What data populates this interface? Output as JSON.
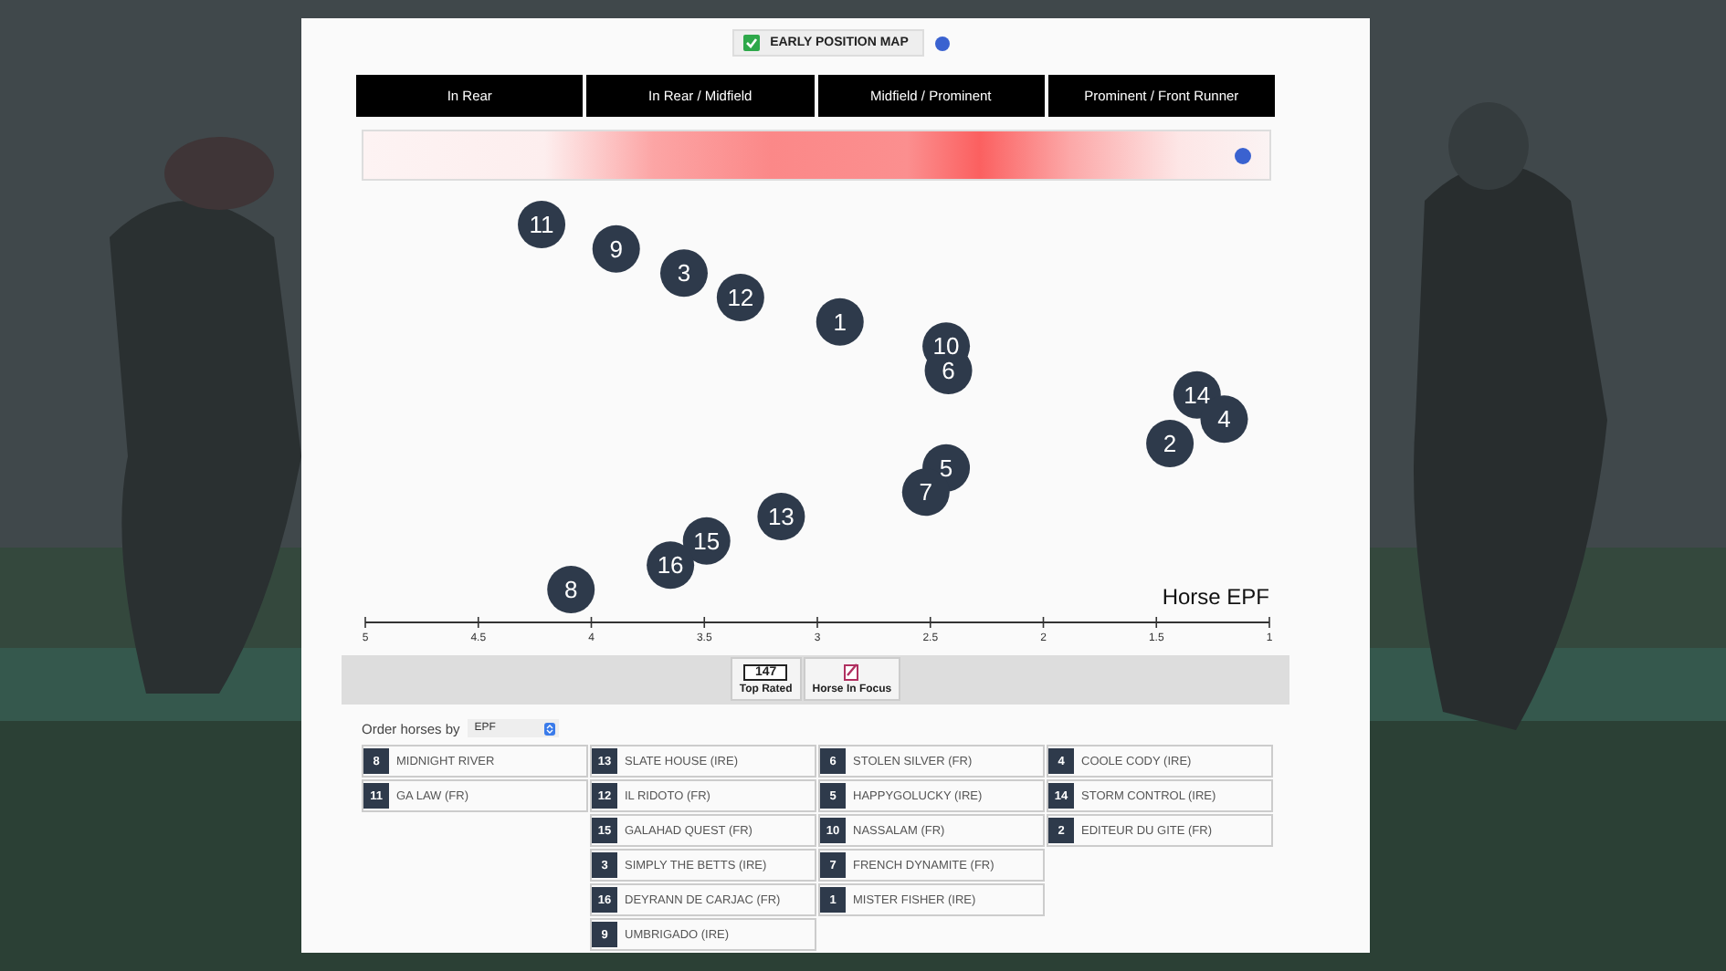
{
  "toggle": {
    "label": "EARLY POSITION MAP",
    "checked": true
  },
  "bands": [
    "In Rear",
    "In Rear / Midfield",
    "Midfield / Prominent",
    "Prominent / Front Runner"
  ],
  "plot": {
    "chart_data": {
      "type": "scatter",
      "xlabel": "Horse EPF",
      "xlim": [
        5,
        1
      ],
      "orientation": "horizontal",
      "xticks": [
        5,
        4.5,
        4,
        3.5,
        3,
        2.5,
        2,
        1.5,
        1
      ],
      "categories": [
        "11",
        "9",
        "3",
        "12",
        "1",
        "10",
        "6",
        "14",
        "4",
        "2",
        "5",
        "7",
        "13",
        "15",
        "16",
        "8"
      ],
      "series": [
        {
          "color": "#2e3a4b",
          "values": [
            4.22,
            3.89,
            3.59,
            3.34,
            2.9,
            2.43,
            2.42,
            1.32,
            1.2,
            1.44,
            2.43,
            2.52,
            3.16,
            3.49,
            3.65,
            4.09
          ]
        }
      ]
    }
  },
  "filters": [
    {
      "kind": "rating",
      "value": "147",
      "label": "Top Rated"
    },
    {
      "kind": "focus",
      "label": "Horse In Focus"
    }
  ],
  "order": {
    "label": "Order horses by",
    "value": "EPF"
  },
  "columns": [
    [
      {
        "number": "8",
        "name": "MIDNIGHT RIVER"
      },
      {
        "number": "11",
        "name": "GA LAW (FR)"
      }
    ],
    [
      {
        "number": "13",
        "name": "SLATE HOUSE (IRE)"
      },
      {
        "number": "12",
        "name": "IL RIDOTO (FR)"
      },
      {
        "number": "15",
        "name": "GALAHAD QUEST (FR)"
      },
      {
        "number": "3",
        "name": "SIMPLY THE BETTS (IRE)"
      },
      {
        "number": "16",
        "name": "DEYRANN DE CARJAC (FR)"
      },
      {
        "number": "9",
        "name": "UMBRIGADO (IRE)"
      }
    ],
    [
      {
        "number": "6",
        "name": "STOLEN SILVER (FR)"
      },
      {
        "number": "5",
        "name": "HAPPYGOLUCKY (IRE)"
      },
      {
        "number": "10",
        "name": "NASSALAM (FR)"
      },
      {
        "number": "7",
        "name": "FRENCH DYNAMITE (FR)"
      },
      {
        "number": "1",
        "name": "MISTER FISHER (IRE)"
      }
    ],
    [
      {
        "number": "4",
        "name": "COOLE CODY (IRE)"
      },
      {
        "number": "14",
        "name": "STORM CONTROL (IRE)"
      },
      {
        "number": "2",
        "name": "EDITEUR DU GITE (FR)"
      }
    ]
  ]
}
